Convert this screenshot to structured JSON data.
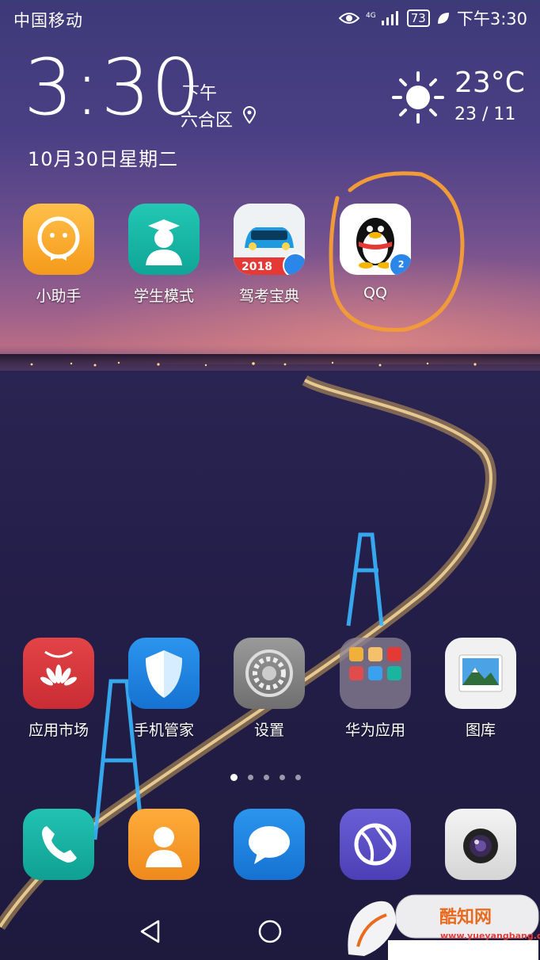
{
  "status_bar": {
    "carrier": "中国移动",
    "network": "4G",
    "battery": "73",
    "time": "下午3:30"
  },
  "clock_widget": {
    "time": "3:30",
    "ampm": "下午",
    "district": "六合区",
    "date": "10月30日星期二",
    "temperature": "23°C",
    "temp_range": "23 / 11",
    "weather_icon": "sun-icon"
  },
  "apps_top": [
    {
      "label": "小助手",
      "icon": "assistant-icon",
      "color": "#f5a623"
    },
    {
      "label": "学生模式",
      "icon": "student-icon",
      "color": "#14b5a8"
    },
    {
      "label": "驾考宝典",
      "icon": "car-icon",
      "color": "#e53935"
    },
    {
      "label": "QQ",
      "icon": "qq-penguin-icon",
      "color": "#ffffff"
    }
  ],
  "apps_bottom": [
    {
      "label": "应用市场",
      "icon": "huawei-appgallery-icon",
      "color": "#d62e34"
    },
    {
      "label": "手机管家",
      "icon": "shield-icon",
      "color": "#1e88e5"
    },
    {
      "label": "设置",
      "icon": "gear-icon",
      "color": "#8a8a8a"
    },
    {
      "label": "华为应用",
      "icon": "folder-icon",
      "color": "#7a6f80"
    },
    {
      "label": "图库",
      "icon": "gallery-icon",
      "color": "#f2f2f2"
    }
  ],
  "dock": [
    {
      "icon": "phone-icon",
      "color": "#17b1a3"
    },
    {
      "icon": "contacts-icon",
      "color": "#f59b2b"
    },
    {
      "icon": "messages-icon",
      "color": "#1e88e5"
    },
    {
      "icon": "browser-icon",
      "color": "#5b4fc4"
    },
    {
      "icon": "camera-icon",
      "color": "#e8e8e8"
    }
  ],
  "page_indicator": {
    "count": 5,
    "active": 1
  },
  "app_badges": {
    "car": "2018",
    "qq": "2"
  },
  "watermark": {
    "text": "酷知网",
    "url": "www.yueyangbang.com"
  }
}
